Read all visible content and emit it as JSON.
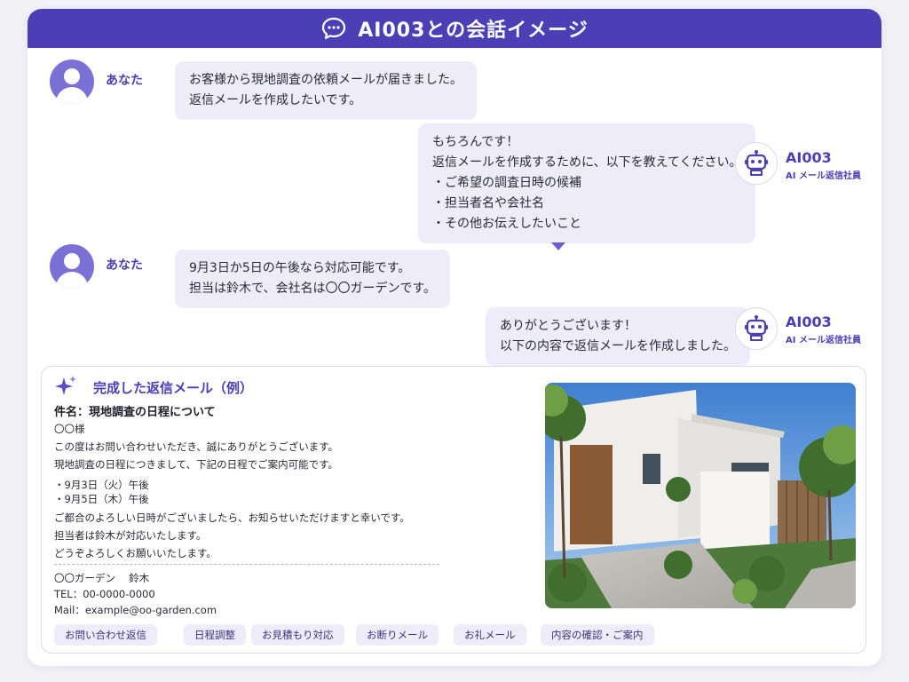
{
  "header": {
    "title": "AI003との会話イメージ",
    "icon": "chat-bubble-icon"
  },
  "user": {
    "name": "あなた",
    "icon": "user-avatar-icon"
  },
  "bot": {
    "name": "AI003",
    "role": "AI メール返信社員",
    "icon": "robot-icon"
  },
  "conversation": [
    {
      "speaker": "user",
      "lines": [
        "お客様から現地調査の依頼メールが届きました。",
        "返信メールを作成したいです。"
      ]
    },
    {
      "speaker": "bot",
      "lines": [
        "もちろんです！",
        "返信メールを作成するために、以下を教えてください。",
        "・ご希望の調査日時の候補",
        "・担当者名や会社名",
        "・その他お伝えしたいこと"
      ]
    },
    {
      "speaker": "user",
      "lines": [
        "9月3日か5日の午後なら対応可能です。",
        "担当は鈴木で、会社名は〇〇ガーデンです。"
      ]
    },
    {
      "speaker": "bot",
      "lines": [
        "ありがとうございます！",
        "以下の内容で返信メールを作成しました。"
      ]
    }
  ],
  "result": {
    "title": "完成した返信メール（例）",
    "icon": "sparkle-icon",
    "subject": "件名：現地調査の日程について",
    "body": [
      "〇〇様",
      "この度はお問い合わせいただき、誠にありがとうございます。",
      "現地調査の日程につきまして、下記の日程でご案内可能です。",
      "・9月3日（火）午後",
      "・9月5日（木）午後",
      "ご都合のよろしい日時がございましたら、お知らせいただけますと幸いです。",
      "担当者は鈴木が対応いたします。",
      "どうぞよろしくお願いいたします。"
    ],
    "signature": [
      "〇〇ガーデン　 鈴木",
      "TEL：00-0000-0000",
      "Mail：example@oo-garden.com"
    ],
    "photo": "modern-white-house-photo"
  },
  "tags": [
    "お問い合わせ返信",
    "日程調整",
    "お見積もり対応",
    "お断りメール",
    "お礼メール",
    "内容の確認・ご案内"
  ],
  "colors": {
    "accent": "#4a3fb4",
    "bubble": "#edecf8",
    "avatar": "#7b70d6",
    "background": "#f1f1f6"
  }
}
